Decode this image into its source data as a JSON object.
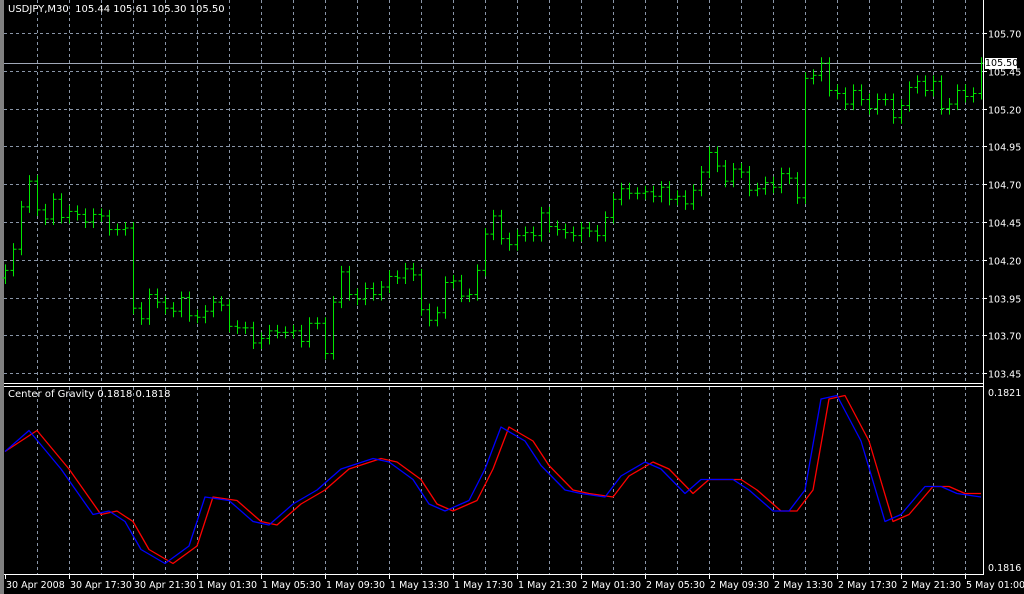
{
  "header": {
    "symbol": "USDJPY,M30",
    "ohlc": "105.44 105.61 105.30 105.50"
  },
  "indicator": {
    "label": "Center of Gravity 0.1818 0.1818",
    "max_label": "0.1821",
    "min_label": "0.1816"
  },
  "bid": {
    "label": "105.50",
    "value": 105.5
  },
  "colors": {
    "background": "#000000",
    "grid": "#8a96a8",
    "bars": "#00e600",
    "cog_main": "#0000ff",
    "cog_signal": "#ff0000",
    "axis": "#ffffff"
  },
  "chart_data": [
    {
      "type": "ohlc-bar",
      "title": "USDJPY,M30",
      "y_ticks": [
        "105.70",
        "105.45",
        "105.20",
        "104.95",
        "104.70",
        "104.45",
        "104.20",
        "103.95",
        "103.70",
        "103.45"
      ],
      "ylim": [
        103.4,
        105.9
      ],
      "x_ticks": [
        "30 Apr 2008",
        "30 Apr 17:30",
        "30 Apr 21:30",
        "1 May 01:30",
        "1 May 05:30",
        "1 May 09:30",
        "1 May 13:30",
        "1 May 17:30",
        "1 May 21:30",
        "2 May 01:30",
        "2 May 05:30",
        "2 May 09:30",
        "2 May 13:30",
        "2 May 17:30",
        "2 May 21:30",
        "5 May 01:00"
      ],
      "close": [
        104.13,
        104.27,
        104.55,
        104.72,
        104.53,
        104.47,
        104.6,
        104.48,
        104.52,
        104.5,
        104.45,
        104.5,
        104.49,
        104.4,
        104.4,
        104.41,
        103.88,
        103.81,
        103.97,
        103.92,
        103.88,
        103.86,
        103.95,
        103.83,
        103.82,
        103.86,
        103.92,
        103.9,
        103.76,
        103.75,
        103.75,
        103.65,
        103.68,
        103.73,
        103.72,
        103.72,
        103.73,
        103.66,
        103.78,
        103.78,
        103.58,
        103.92,
        104.12,
        103.97,
        103.94,
        104.01,
        103.97,
        104.02,
        104.09,
        104.08,
        104.14,
        104.1,
        103.87,
        103.8,
        103.85,
        104.05,
        104.06,
        103.96,
        103.97,
        104.13,
        104.37,
        104.49,
        104.34,
        104.3,
        104.36,
        104.38,
        104.36,
        104.51,
        104.42,
        104.4,
        104.38,
        104.36,
        104.41,
        104.39,
        104.36,
        104.48,
        104.6,
        104.67,
        104.64,
        104.64,
        104.65,
        104.62,
        104.68,
        104.6,
        104.62,
        104.57,
        104.66,
        104.78,
        104.91,
        104.82,
        104.72,
        104.8,
        104.78,
        104.66,
        104.67,
        104.71,
        104.68,
        104.77,
        104.74,
        104.61,
        105.4,
        105.42,
        105.5,
        105.32,
        105.3,
        105.23,
        105.32,
        105.26,
        105.2,
        105.26,
        105.26,
        105.14,
        105.22,
        105.34,
        105.38,
        105.32,
        105.38,
        105.2,
        105.23,
        105.32,
        105.28,
        105.3,
        105.5
      ]
    },
    {
      "type": "line",
      "title": "Center of Gravity",
      "ylim": [
        0.1816,
        0.1821
      ],
      "series": [
        {
          "name": "CoG",
          "color": "#0000ff",
          "bar": [
            0,
            3,
            7,
            11,
            13,
            15,
            17,
            20,
            23,
            25,
            28,
            31,
            33,
            36,
            39,
            42,
            46,
            48,
            51,
            53,
            55,
            58,
            60,
            62,
            65,
            67,
            70,
            72,
            75,
            77,
            80,
            82,
            85,
            87,
            91,
            93,
            96,
            98,
            100,
            102,
            104,
            107,
            110,
            112,
            115,
            117,
            119,
            122
          ],
          "values": [
            0.18193,
            0.18199,
            0.18188,
            0.18175,
            0.18176,
            0.18173,
            0.18165,
            0.18161,
            0.18166,
            0.1818,
            0.18179,
            0.18173,
            0.18172,
            0.18178,
            0.18182,
            0.18188,
            0.18191,
            0.1819,
            0.18185,
            0.18178,
            0.18176,
            0.18179,
            0.18188,
            0.182,
            0.18196,
            0.18189,
            0.18182,
            0.18181,
            0.1818,
            0.18186,
            0.1819,
            0.18188,
            0.18181,
            0.18185,
            0.18185,
            0.18182,
            0.18176,
            0.18176,
            0.18182,
            0.18208,
            0.18209,
            0.18196,
            0.18173,
            0.18175,
            0.18183,
            0.18183,
            0.18181,
            0.1818
          ]
        },
        {
          "name": "Signal",
          "color": "#ff0000",
          "bar": [
            0,
            4,
            8,
            12,
            14,
            16,
            18,
            21,
            24,
            26,
            29,
            32,
            34,
            37,
            40,
            43,
            47,
            49,
            52,
            54,
            56,
            59,
            61,
            63,
            66,
            68,
            71,
            73,
            76,
            78,
            81,
            83,
            86,
            88,
            92,
            94,
            97,
            99,
            101,
            103,
            105,
            108,
            111,
            113,
            116,
            118,
            120,
            122
          ],
          "values": [
            0.18193,
            0.18199,
            0.18188,
            0.18175,
            0.18176,
            0.18173,
            0.18165,
            0.18161,
            0.18166,
            0.1818,
            0.18179,
            0.18173,
            0.18172,
            0.18178,
            0.18182,
            0.18188,
            0.18191,
            0.1819,
            0.18185,
            0.18178,
            0.18176,
            0.18179,
            0.18188,
            0.182,
            0.18196,
            0.18189,
            0.18182,
            0.18181,
            0.1818,
            0.18186,
            0.1819,
            0.18188,
            0.18181,
            0.18185,
            0.18185,
            0.18182,
            0.18176,
            0.18176,
            0.18182,
            0.18208,
            0.18209,
            0.18196,
            0.18173,
            0.18175,
            0.18183,
            0.18183,
            0.18181,
            0.18181
          ]
        }
      ]
    }
  ]
}
